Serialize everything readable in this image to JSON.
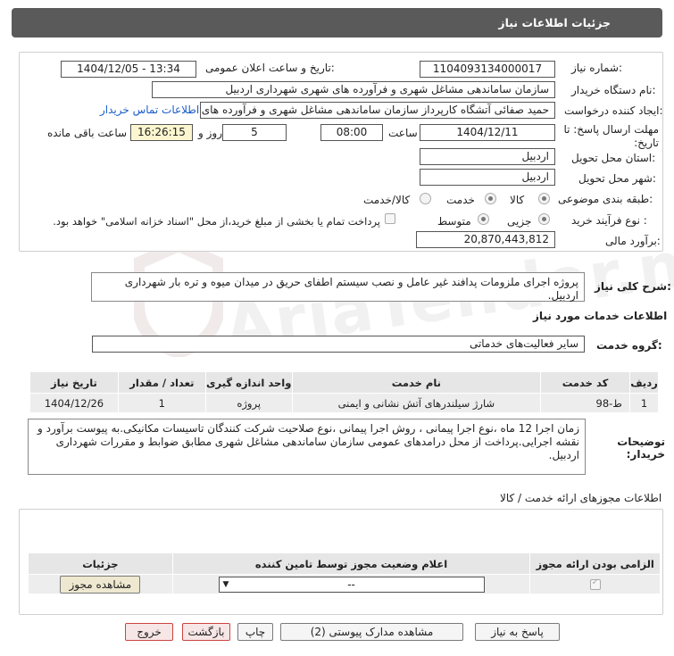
{
  "header": {
    "title": "جزئیات اطلاعات نیاز"
  },
  "form": {
    "need_number_label": "شماره نیاز:",
    "need_number": "1104093134000017",
    "announce_label": "تاریخ و ساعت اعلان عمومی:",
    "announce_value": "1404/12/05 - 13:34",
    "buyer_org_label": "نام دستگاه خریدار:",
    "buyer_org": "سازمان ساماندهی مشاغل شهری و فرآورده های شهری شهرداری اردبیل",
    "creator_label": "ایجاد کننده درخواست:",
    "creator": "حمید صفائی آتشگاه کارپرداز سازمان ساماندهی مشاغل شهری و فرآورده های شهری شهرداری اردبیل",
    "contact_link": "اطلاعات تماس خریدار",
    "deadline_label": "مهلت ارسال پاسخ: تا تاریخ:",
    "deadline_date": "1404/12/11",
    "time_label": "ساعت",
    "deadline_time": "08:00",
    "days_value": "5",
    "days_label": "روز و",
    "remaining_time": "16:26:15",
    "remaining_label": "ساعت باقی مانده",
    "province_label": "استان محل تحویل:",
    "province": "اردبیل",
    "city_label": "شهر محل تحویل:",
    "city": "اردبیل",
    "category_label": "طبقه بندی موضوعی:",
    "cat_goods": "کالا",
    "cat_service": "خدمت",
    "cat_both": "کالا/خدمت",
    "process_label": "نوع فرآیند خرید :",
    "proc_partial": "جزیی",
    "proc_medium": "متوسط",
    "payment_note": "پرداخت تمام یا بخشی از مبلغ خرید،از محل \"اسناد خزانه اسلامی\" خواهد بود.",
    "estimate_label": "برآورد مالی:",
    "estimate": "20,870,443,812"
  },
  "summary": {
    "label": "شرح کلی نیاز:",
    "text": "پروژه اجرای ملزومات پدافند غیر عامل و نصب سیستم اطفای حریق در میدان میوه و تره بار شهرداری اردبیل."
  },
  "services": {
    "section_title": "اطلاعات خدمات مورد نیاز",
    "group_label": "گروه خدمت:",
    "group_value": "سایر فعالیت‌های خدماتی",
    "headers": [
      "ردیف",
      "کد خدمت",
      "نام خدمت",
      "واحد اندازه گیری",
      "تعداد / مقدار",
      "تاریخ نیاز"
    ],
    "rows": [
      [
        "1",
        "ط-98",
        "شارژ سیلندرهای آتش نشانی و ایمنی",
        "پروژه",
        "1",
        "1404/12/26"
      ]
    ]
  },
  "buyer_notes": {
    "label": "توضیحات خریدار:",
    "text": "زمان اجرا 12 ماه ،نوع اجرا پیمانی ، روش اجرا پیمانی ،نوع صلاحیت شرکت کنندگان تاسیسات مکانیکی.به پیوست برآورد و نقشه اجرایی.پرداخت از محل درامدهای عمومی سازمان ساماندهی مشاغل شهری مطابق ضوابط و مقررات شهرداری اردبیل."
  },
  "permits": {
    "title": "اطلاعات مجوزهای ارائه خدمت / کالا",
    "headers": [
      "الزامی بودن ارائه مجوز",
      "اعلام وضعیت مجوز توسط تامین کننده",
      "جزئیات"
    ],
    "select_value": "--",
    "view_button": "مشاهده مجوز"
  },
  "buttons": {
    "reply": "پاسخ به نیاز",
    "view_docs": "مشاهده مدارک پیوستی (2)",
    "print": "چاپ",
    "back": "بازگشت",
    "exit": "خروج"
  },
  "watermark": "AriaTender.net",
  "colors": {
    "header_bg": "#5a5a5a",
    "time_bg": "#fbf6cf",
    "link": "#1a5cc8"
  }
}
